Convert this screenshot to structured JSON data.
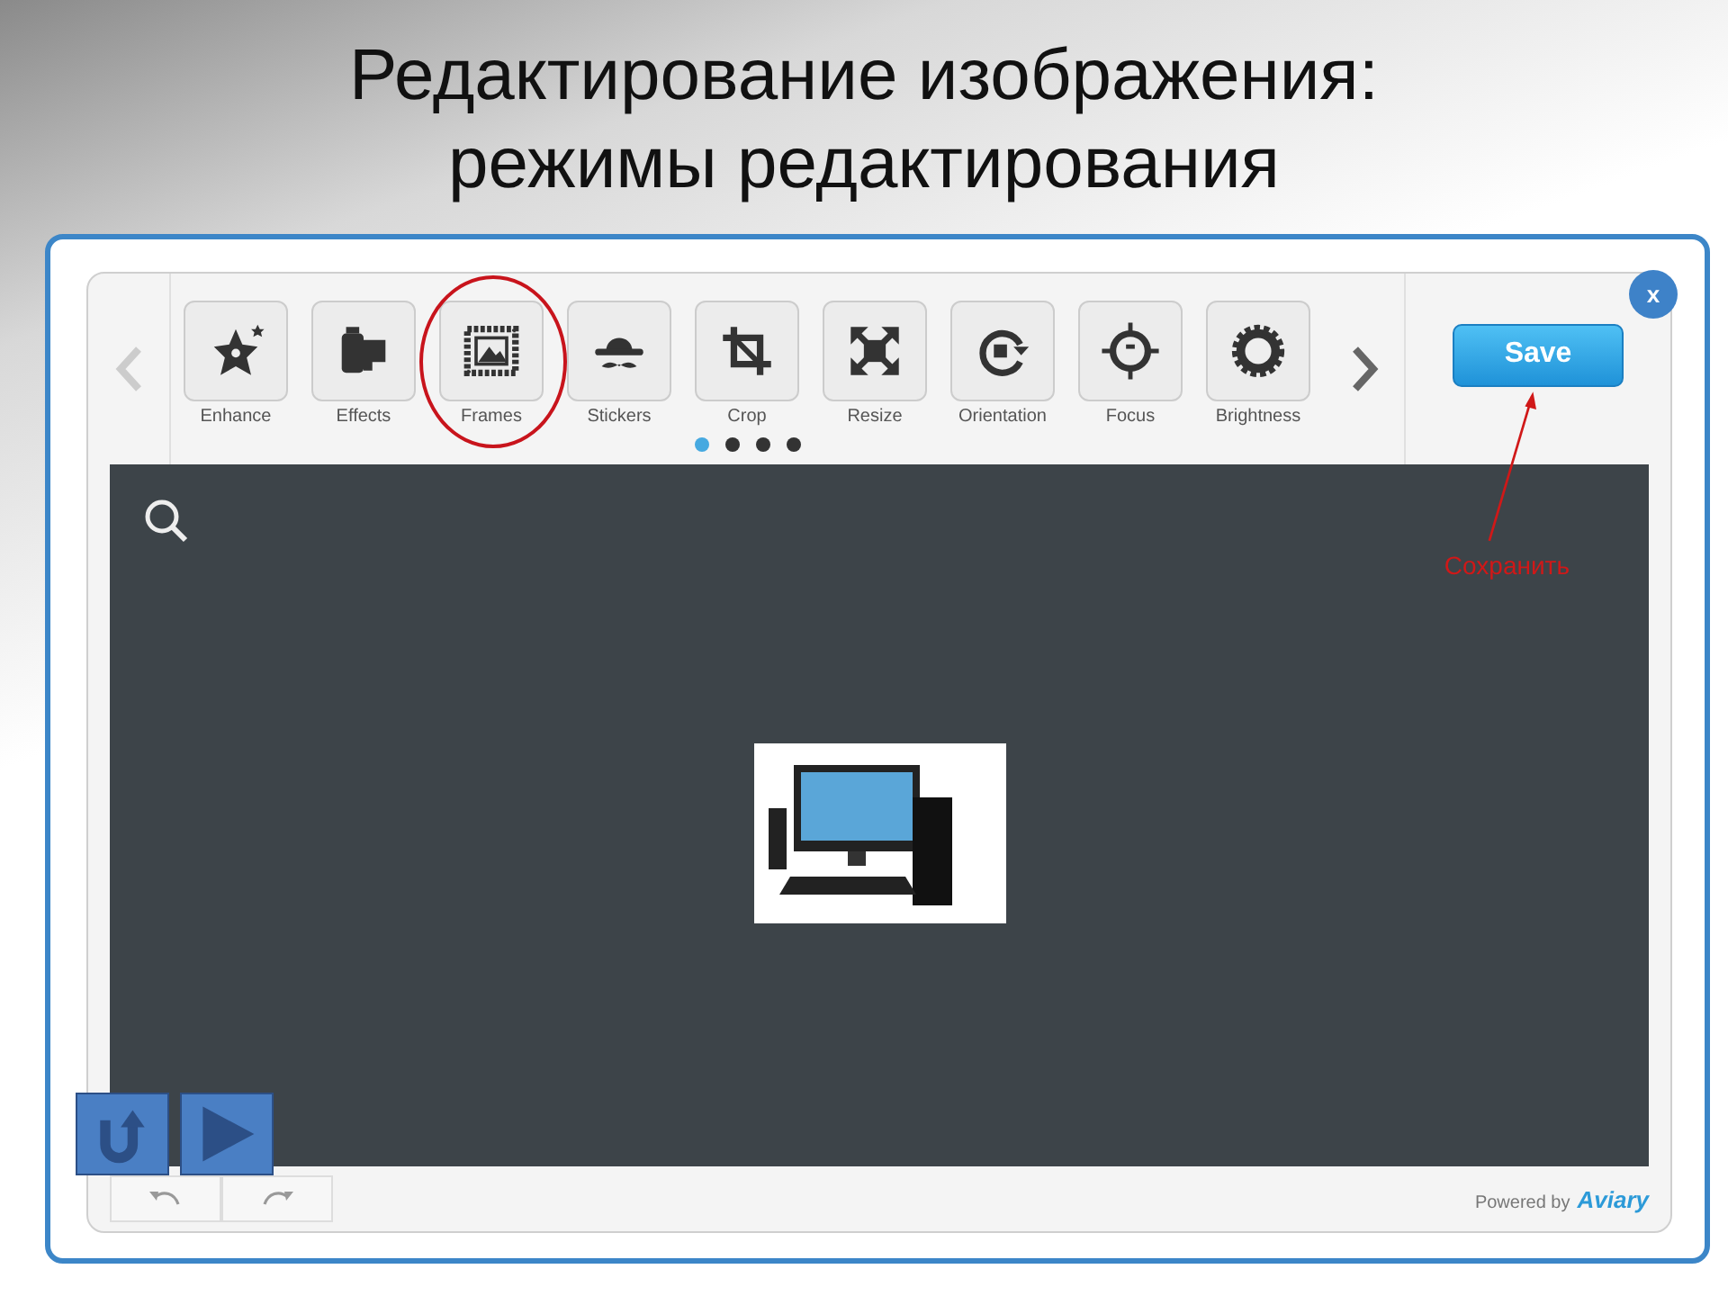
{
  "slide": {
    "title_lines": [
      "Редактирование изображения:",
      "режимы редактирования"
    ]
  },
  "editor": {
    "tools": [
      {
        "label": "Enhance",
        "kind": "enhance",
        "highlighted": false
      },
      {
        "label": "Effects",
        "kind": "effects",
        "highlighted": false
      },
      {
        "label": "Frames",
        "kind": "frames",
        "highlighted": true
      },
      {
        "label": "Stickers",
        "kind": "stickers",
        "highlighted": false
      },
      {
        "label": "Crop",
        "kind": "crop",
        "highlighted": false
      },
      {
        "label": "Resize",
        "kind": "resize",
        "highlighted": false
      },
      {
        "label": "Orientation",
        "kind": "orientation",
        "highlighted": false
      },
      {
        "label": "Focus",
        "kind": "focus",
        "highlighted": false
      },
      {
        "label": "Brightness",
        "kind": "brightness",
        "highlighted": false
      }
    ],
    "page_dots": [
      {
        "selected": true
      },
      {
        "selected": false
      },
      {
        "selected": false
      },
      {
        "selected": false
      }
    ],
    "save_button": "Save",
    "close_button": "x",
    "annotation": "Сохранить",
    "footer": {
      "credit": "Powered by",
      "logo": "Aviary"
    }
  }
}
